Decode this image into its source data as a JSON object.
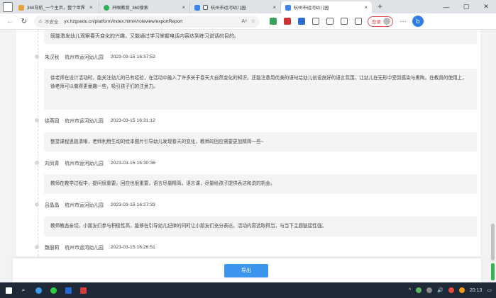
{
  "browser": {
    "tabs": [
      {
        "label": "360导航_一个主页，整个世界",
        "icon": "globe-icon",
        "color": "#e9a23b"
      },
      {
        "label": "开眼教育_360搜索",
        "icon": "search-icon",
        "color": "#2fb05a"
      },
      {
        "label": "杭州市运河幼儿园",
        "icon": "speaker-icon",
        "color": "#3a86e8"
      },
      {
        "label": "杭州市运河幼儿园",
        "icon": "page-icon",
        "color": "#3a86e8",
        "active": true
      }
    ],
    "security_label": "不安全",
    "url": "yx.hzgsedu.cn/platform/index.html#/roleview/exportReport",
    "login_label": "登录"
  },
  "first_comment": "既能激发幼儿观察春天变化的兴趣，又能通过学习掌握电话内容达到练习说话的目的。",
  "entries": [
    {
      "name": "朱汉秋",
      "school": "杭州市运河幼儿园",
      "time": "2023-03-15 16:37:52",
      "comment": "徐老师在设计活动时，能关注幼儿的已有经验，在活动中融入了许多关于春天大自然变化的知识，还能注意用优美的语句给幼儿创设良好的语言氛围，让幼儿在无形中受到感染与熏陶。在教具的使用上，徐老师可以做得更童趣一些，吸引孩子们的注意力。"
    },
    {
      "name": "徐燕园",
      "school": "杭州市运河幼儿园",
      "time": "2023-03-15 16:31:12",
      "comment": "整堂课程思路清晰，老师利用生动的绘本图片引导幼儿发现春天的变化，教师的回应需要更加精简一些~"
    },
    {
      "name": "刘凤青",
      "school": "杭州市运河幼儿园",
      "time": "2023-03-15 16:30:36",
      "comment": "教师在教学过程中，提问很重要，回应也很重要，语言尽量精简。语言课，尽量给孩子提供表达和说的机会。"
    },
    {
      "name": "吕晶晶",
      "school": "杭州市运河幼儿园",
      "time": "2023-03-15 16:27:33",
      "comment": "教师教态亲切，小朋友们参与积极性高，能够在引导幼儿纪律的同时让小朋友们充分表达。活动内容选取得当，与当下主题链接性强。"
    },
    {
      "name": "魏丽莉",
      "school": "杭州市运河幼儿园",
      "time": "2023-03-15 16:26:51",
      "comment": ""
    }
  ],
  "export_label": "导出",
  "taskbar": {
    "clock": "20:13"
  }
}
